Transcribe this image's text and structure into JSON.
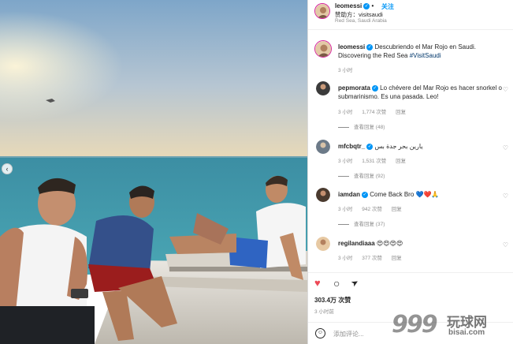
{
  "post": {
    "username": "leomessi",
    "follow_label": "关注",
    "dot": "•",
    "sponsor": "赞助方：visitsaudi",
    "location": "Red Sea, Saudi Arabia"
  },
  "caption": {
    "username": "leomessi",
    "text_line1": "Descubriendo el Mar Rojo en Saudi.",
    "text_line2": "Discovering the Red Sea",
    "hashtag": "#VisitSaudi",
    "time": "3 小时"
  },
  "comments": [
    {
      "username": "pepmorata",
      "text": "Lo chévere del Mar Rojo es hacer snorkel o submarinismo. Es una pasada. Leo!",
      "time": "3 小时",
      "likes": "1,774 次赞",
      "reply": "回复",
      "view_replies": "查看回复 (48)"
    },
    {
      "username": "mfcbqtr_",
      "text": "يارين بحر جدة بس",
      "time": "3 小时",
      "likes": "1,531 次赞",
      "reply": "回复",
      "view_replies": "查看回复 (92)"
    },
    {
      "username": "iamdan",
      "text": "Come Back Bro 💙❤️🙏",
      "time": "3 小时",
      "likes": "942 次赞",
      "reply": "回复",
      "view_replies": "查看回复 (37)"
    },
    {
      "username": "regilandiaaa",
      "text": "😍😍😍😍",
      "time": "3 小时",
      "likes": "377 次赞",
      "reply": "回复"
    }
  ],
  "actions": {
    "likes": "303.4万 次赞",
    "time": "3 小时前",
    "add_comment_placeholder": "添加评论...",
    "heart_icon": "♥",
    "comment_icon": "○",
    "share_icon": "➤"
  },
  "watermark": {
    "number": "999",
    "cn": "玩球网",
    "domain": "bisai.com"
  },
  "colors": {
    "accent": "#0095f6",
    "like_red": "#ed4956",
    "sea": "#3a8fa8",
    "sky": "#8eb2cf"
  }
}
